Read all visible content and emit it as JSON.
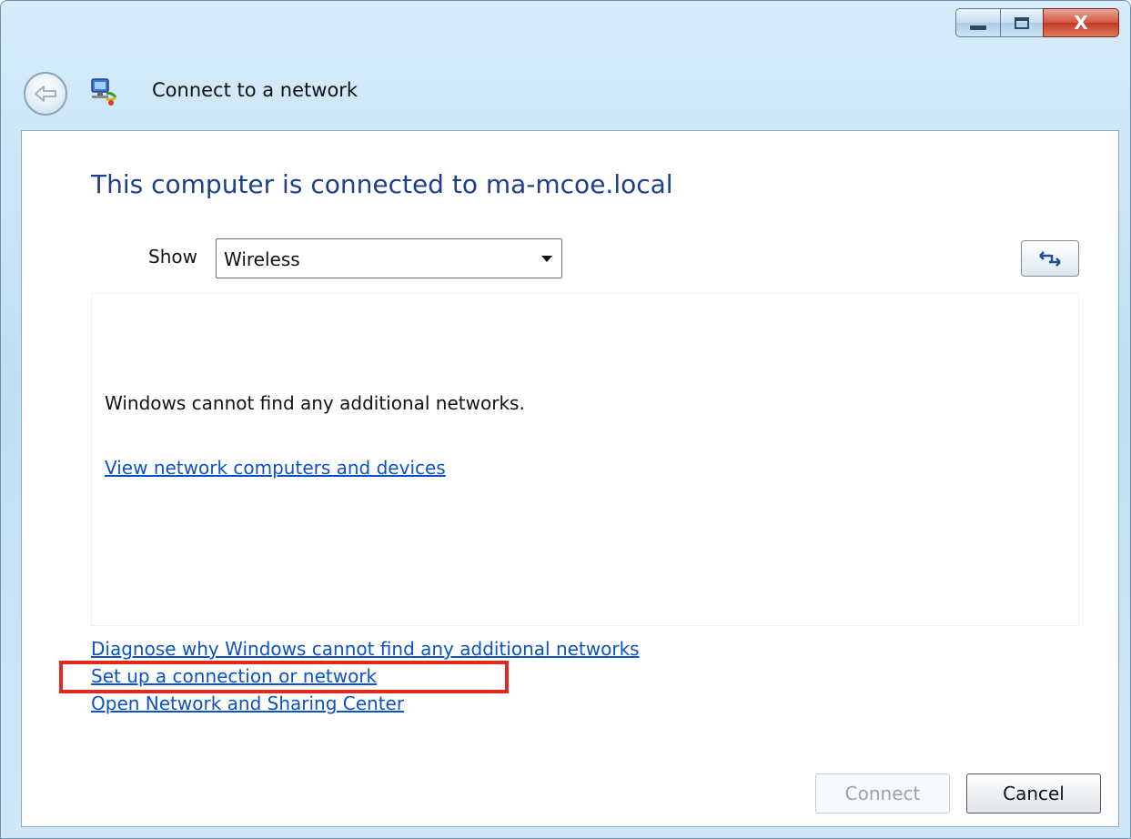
{
  "window": {
    "title": "Connect to a network",
    "close_glyph": "X"
  },
  "icons": {
    "back": "back-arrow-icon",
    "network": "network-connect-icon",
    "refresh": "refresh-arrows-icon"
  },
  "main": {
    "heading": "This computer is connected to ma-mcoe.local",
    "show_label": "Show",
    "show_value": "Wireless",
    "empty_message": "Windows cannot find any additional networks.",
    "view_devices_link": "View network computers and devices"
  },
  "links": {
    "diagnose": "Diagnose why Windows cannot find any additional networks",
    "setup": "Set up a connection or network",
    "sharing_center": "Open Network and Sharing Center"
  },
  "buttons": {
    "connect": "Connect",
    "cancel": "Cancel"
  },
  "colors": {
    "heading": "#1e3f8e",
    "link": "#0b53c4",
    "highlight": "#e02a1c"
  }
}
